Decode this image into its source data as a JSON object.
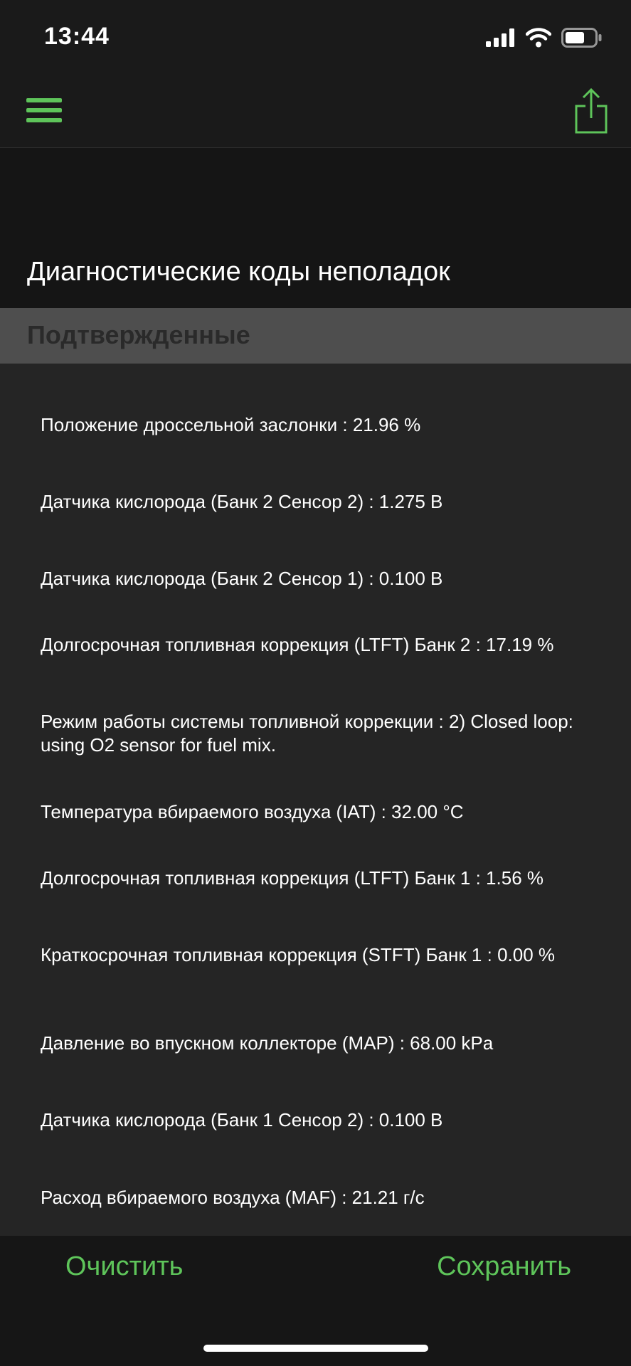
{
  "status_bar": {
    "time": "13:44"
  },
  "header": {
    "menu_icon": "hamburger-menu-icon",
    "share_icon": "share-icon",
    "accent_color": "#5ec45a"
  },
  "page": {
    "title": "Диагностические коды неполадок"
  },
  "section": {
    "title": "Подтвержденные"
  },
  "items": [
    {
      "text": "Положение дроссельной заслонки : 21.96 %"
    },
    {
      "text": "Датчика кислорода (Банк 2 Сенсор 2) : 1.275 В"
    },
    {
      "text": "Датчика кислорода (Банк 2 Сенсор 1) : 0.100 В"
    },
    {
      "text": "Долгосрочная топливная коррекция (LTFT) Банк 2 : 17.19 %"
    },
    {
      "text": "Режим работы системы топливной коррекции : 2) Closed loop: using O2 sensor for fuel mix."
    },
    {
      "text": "Температура вбираемого воздуха (IAT) : 32.00 °C"
    },
    {
      "text": "Долгосрочная топливная коррекция (LTFT) Банк 1 : 1.56 %"
    },
    {
      "text": "Краткосрочная топливная коррекция (STFT) Банк 1 : 0.00 %"
    },
    {
      "text": "Давление во впускном коллекторе (MAP) : 68.00 kPa"
    },
    {
      "text": "Датчика кислорода (Банк 1 Сенсор 2) : 0.100 В"
    },
    {
      "text": "Расход вбираемого воздуха (MAF) : 21.21 г/с"
    }
  ],
  "footer": {
    "clear_label": "Очистить",
    "save_label": "Сохранить"
  }
}
